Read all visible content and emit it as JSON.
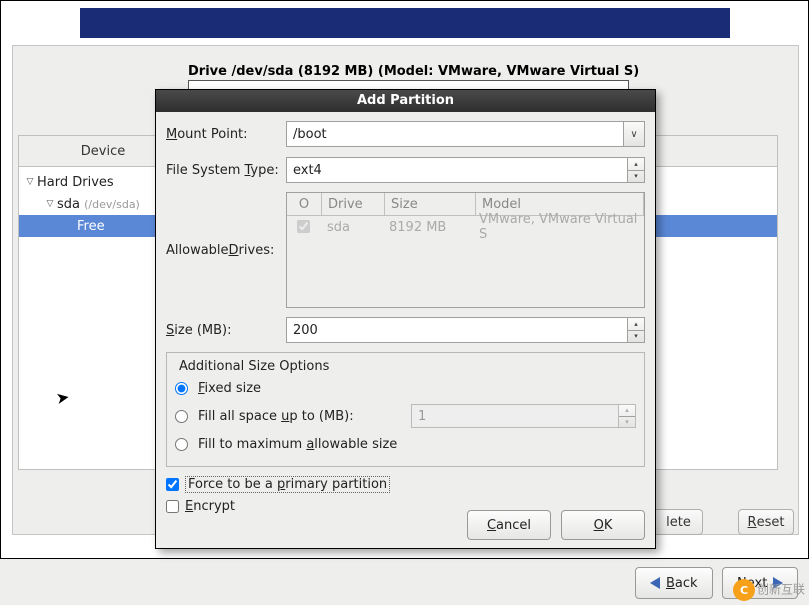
{
  "header": {
    "drive_label": "Drive /dev/sda (8192 MB) (Model: VMware, VMware Virtual S)"
  },
  "tree": {
    "header_device": "Device",
    "rows": [
      {
        "label": "Hard Drives"
      },
      {
        "label": "sda",
        "dim": "(/dev/sda)"
      },
      {
        "label": "Free"
      }
    ]
  },
  "toolbar": {
    "delete_stub": "lete",
    "reset_prefix": "R",
    "reset_suffix": "eset"
  },
  "nav": {
    "back_prefix": "B",
    "back_suffix": "ack",
    "next_prefix": "N",
    "next_suffix": "ext"
  },
  "dialog": {
    "title": "Add Partition",
    "mount_point": {
      "label_prefix": "M",
      "label_suffix": "ount Point:",
      "value": "/boot"
    },
    "fs_type": {
      "label_prefix": "File System ",
      "label_ul": "T",
      "label_suffix": "ype:",
      "value": "ext4"
    },
    "allowable_drives": {
      "label_prefix": "Allowable ",
      "label_ul": "D",
      "label_suffix": "rives:",
      "columns": {
        "chk": "O",
        "drive": "Drive",
        "size": "Size",
        "model": "Model"
      },
      "row": {
        "checked": true,
        "drive": "sda",
        "size": "8192 MB",
        "model": "VMware, VMware Virtual S"
      }
    },
    "size": {
      "label_prefix": "S",
      "label_suffix": "ize (MB):",
      "value": "200"
    },
    "additional": {
      "legend": "Additional Size Options",
      "fixed_prefix": "F",
      "fixed_suffix": "ixed size",
      "fill_up_prefix": "Fill all space ",
      "fill_up_ul": "u",
      "fill_up_suffix": "p to (MB):",
      "fill_up_value": "1",
      "fill_max_prefix": "Fill to maximum ",
      "fill_max_ul": "a",
      "fill_max_suffix": "llowable size",
      "selected": "fixed"
    },
    "force_primary": {
      "prefix": "Force to be a ",
      "ul": "p",
      "suffix": "rimary partition",
      "checked": true
    },
    "encrypt": {
      "ul": "E",
      "suffix": "ncrypt",
      "checked": false
    },
    "buttons": {
      "cancel_ul": "C",
      "cancel_suffix": "ancel",
      "ok_ul": "O",
      "ok_suffix": "K"
    }
  },
  "watermark": "创新互联"
}
